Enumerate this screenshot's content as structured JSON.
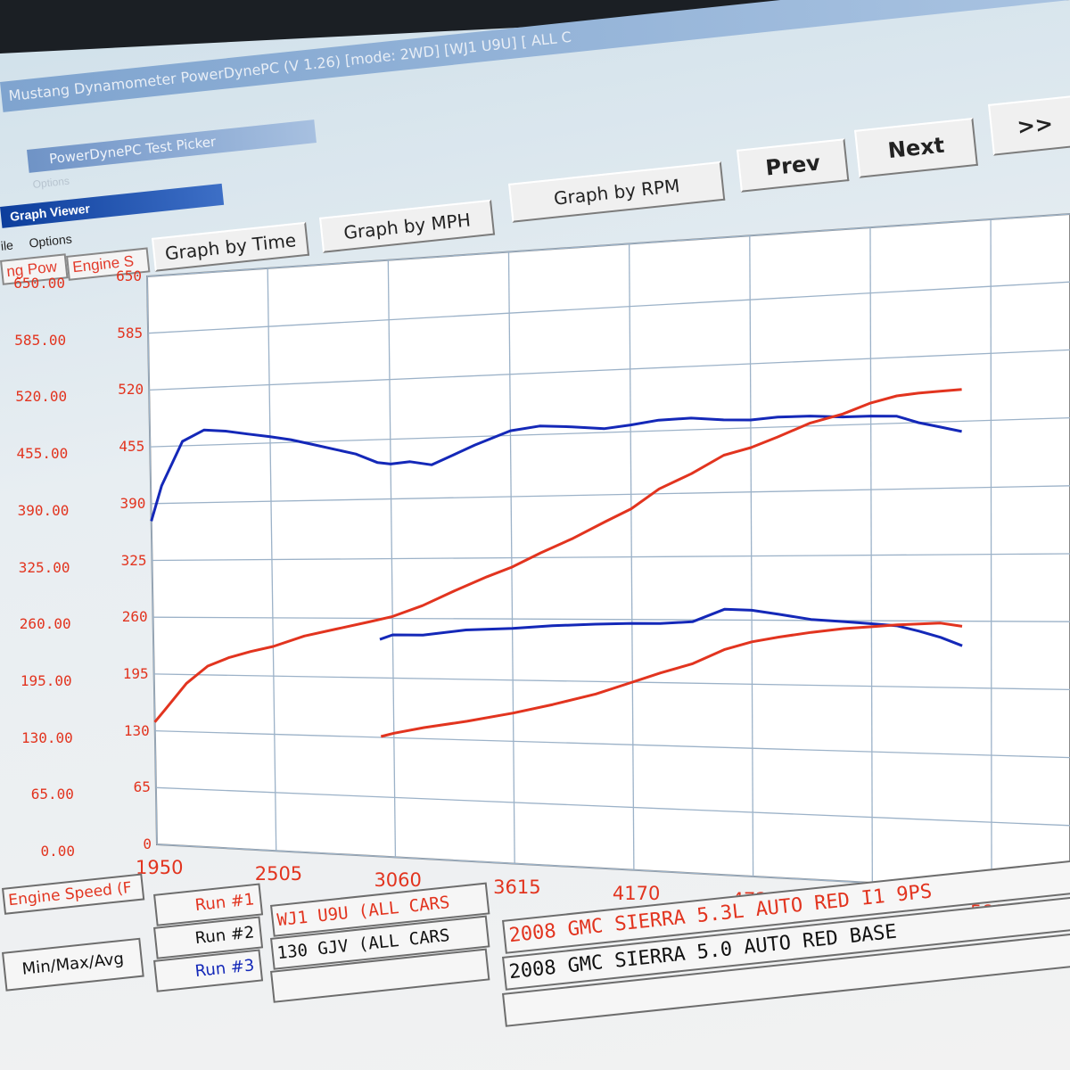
{
  "background": {
    "main_title": "Mustang Dynamometer PowerDynePC (V 1.26) [mode: 2WD] [WJ1 U9U] [ ALL C",
    "picker_title": "PowerDynePC Test Picker",
    "picker_menu": "Options"
  },
  "window": {
    "title": "Graph Viewer",
    "menu": [
      "ile",
      "Options"
    ]
  },
  "channels": {
    "left": "ng Pow",
    "right": "Engine S"
  },
  "toolbar": {
    "graph_by_time": "Graph by Time",
    "graph_by_mph": "Graph by MPH",
    "graph_by_rpm": "Graph by RPM",
    "prev": "Prev",
    "next": "Next",
    "more": ">>"
  },
  "left_axis_ticks": [
    "650.00",
    "585.00",
    "520.00",
    "455.00",
    "390.00",
    "325.00",
    "260.00",
    "195.00",
    "130.00",
    "65.00",
    "0.00"
  ],
  "right_axis_ticks": [
    "650",
    "585",
    "520",
    "455",
    "390",
    "325",
    "260",
    "195",
    "130",
    "65",
    "0"
  ],
  "x_axis": {
    "label": "Engine Speed (F",
    "ticks": [
      "1950",
      "2505",
      "3060",
      "3615",
      "4170",
      "4725",
      "5280",
      "5835"
    ]
  },
  "colors": {
    "red": "#e2341f",
    "blue": "#1428b8",
    "grid": "#9cb2c8"
  },
  "chart_data": {
    "type": "line",
    "title": "",
    "xlabel": "Engine Speed (F",
    "ylabel": "",
    "xlim": [
      1950,
      6200
    ],
    "ylim": [
      0,
      650
    ],
    "grid": true,
    "series": [
      {
        "color": "#1428b8",
        "x": [
          1950,
          2000,
          2100,
          2200,
          2300,
          2400,
          2505,
          2600,
          2700,
          2800,
          2900,
          3000,
          3060,
          3150,
          3250,
          3350,
          3450,
          3615,
          3750,
          3900,
          4050,
          4170,
          4300,
          4450,
          4600,
          4725,
          4850,
          5000,
          5150,
          5280,
          5400,
          5500,
          5600,
          5700
        ],
        "values": [
          370,
          410,
          460,
          472,
          470,
          466,
          462,
          458,
          452,
          446,
          440,
          430,
          428,
          430,
          426,
          436,
          446,
          460,
          464,
          462,
          459,
          462,
          466,
          467,
          464,
          463,
          465,
          465,
          463,
          463,
          462,
          455,
          450,
          445
        ]
      },
      {
        "color": "#e2341f",
        "x": [
          1950,
          2000,
          2100,
          2200,
          2300,
          2400,
          2505,
          2650,
          2800,
          2950,
          3060,
          3200,
          3350,
          3500,
          3615,
          3750,
          3900,
          4050,
          4170,
          4300,
          4450,
          4600,
          4725,
          4850,
          5000,
          5150,
          5280,
          5400,
          5500,
          5600,
          5700
        ],
        "values": [
          140,
          155,
          185,
          205,
          215,
          222,
          228,
          240,
          248,
          256,
          262,
          274,
          290,
          305,
          315,
          330,
          345,
          362,
          375,
          395,
          410,
          428,
          435,
          445,
          458,
          466,
          476,
          482,
          484,
          485,
          486
        ]
      },
      {
        "color": "#1428b8",
        "x": [
          3000,
          3060,
          3200,
          3400,
          3615,
          3800,
          4000,
          4170,
          4300,
          4450,
          4600,
          4725,
          4850,
          5000,
          5150,
          5280,
          5400,
          5500,
          5600,
          5700
        ],
        "values": [
          237,
          242,
          242,
          248,
          250,
          253,
          255,
          256,
          256,
          258,
          271,
          270,
          266,
          261,
          259,
          257,
          255,
          250,
          244,
          236
        ]
      },
      {
        "color": "#e2341f",
        "x": [
          3000,
          3060,
          3200,
          3400,
          3615,
          3800,
          4000,
          4170,
          4300,
          4450,
          4600,
          4725,
          4850,
          5000,
          5150,
          5280,
          5400,
          5500,
          5600,
          5700
        ],
        "values": [
          131,
          135,
          142,
          150,
          160,
          170,
          182,
          195,
          205,
          215,
          230,
          238,
          243,
          248,
          252,
          254,
          256,
          257,
          258,
          255
        ]
      }
    ]
  },
  "runs": [
    {
      "label": "Run #1",
      "label_color": "#e2341f",
      "code": "WJ1 U9U (ALL CARS",
      "code_color": "#e2341f",
      "desc": "2008 GMC SIERRA 5.3L AUTO RED I1 9PS",
      "desc_color": "#e2341f"
    },
    {
      "label": "Run #2",
      "label_color": "#111111",
      "code": "130 GJV (ALL CARS",
      "code_color": "#111111",
      "desc": "2008 GMC SIERRA 5.0 AUTO RED BASE",
      "desc_color": "#111111"
    },
    {
      "label": "Run #3",
      "label_color": "#1428b8",
      "code": "",
      "code_color": "#111111",
      "desc": "",
      "desc_color": "#111111"
    }
  ],
  "footer": {
    "minmax_label": "Min/Max/Avg"
  }
}
